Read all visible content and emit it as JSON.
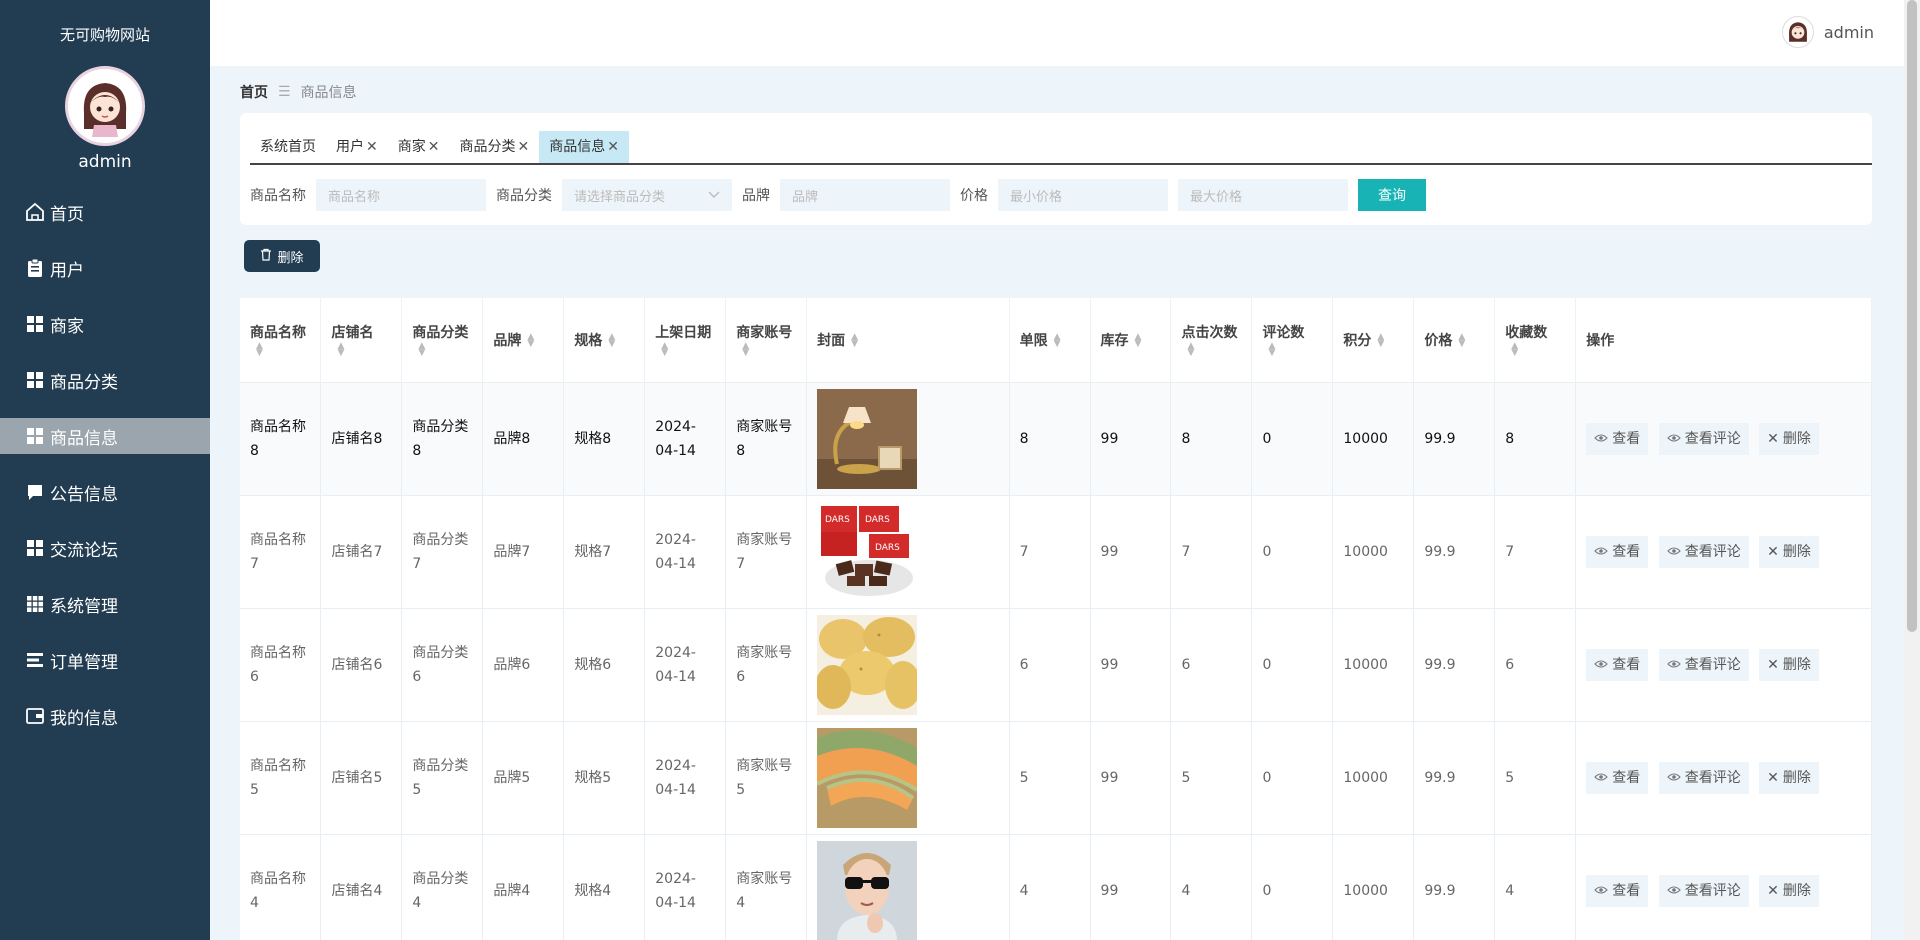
{
  "sidebar": {
    "site_title": "无可购物网站",
    "username": "admin",
    "items": [
      {
        "label": "首页",
        "icon": "home-icon",
        "active": false
      },
      {
        "label": "用户",
        "icon": "clipboard-icon",
        "active": false
      },
      {
        "label": "商家",
        "icon": "grid-icon",
        "active": false
      },
      {
        "label": "商品分类",
        "icon": "grid-icon",
        "active": false
      },
      {
        "label": "商品信息",
        "icon": "grid-icon",
        "active": true
      },
      {
        "label": "公告信息",
        "icon": "chat-icon",
        "active": false
      },
      {
        "label": "交流论坛",
        "icon": "grid-icon",
        "active": false
      },
      {
        "label": "系统管理",
        "icon": "apps-icon",
        "active": false
      },
      {
        "label": "订单管理",
        "icon": "list-icon",
        "active": false
      },
      {
        "label": "我的信息",
        "icon": "wallet-icon",
        "active": false
      }
    ]
  },
  "header": {
    "username": "admin"
  },
  "breadcrumb": {
    "home": "首页",
    "current": "商品信息"
  },
  "tabs": [
    {
      "label": "系统首页",
      "closable": false,
      "active": false
    },
    {
      "label": "用户",
      "closable": true,
      "active": false
    },
    {
      "label": "商家",
      "closable": true,
      "active": false
    },
    {
      "label": "商品分类",
      "closable": true,
      "active": false
    },
    {
      "label": "商品信息",
      "closable": true,
      "active": true
    }
  ],
  "search": {
    "name_label": "商品名称",
    "name_placeholder": "商品名称",
    "category_label": "商品分类",
    "category_placeholder": "请选择商品分类",
    "brand_label": "品牌",
    "brand_placeholder": "品牌",
    "price_label": "价格",
    "min_price_placeholder": "最小价格",
    "max_price_placeholder": "最大价格",
    "query_label": "查询"
  },
  "toolbar": {
    "delete_label": "删除"
  },
  "table": {
    "columns": [
      "商品名称",
      "店铺名",
      "商品分类",
      "品牌",
      "规格",
      "上架日期",
      "商家账号",
      "封面",
      "单限",
      "库存",
      "点击次数",
      "评论数",
      "积分",
      "价格",
      "收藏数",
      "操作"
    ],
    "actions": {
      "view": "查看",
      "comments": "查看评论",
      "delete": "删除"
    },
    "rows": [
      {
        "name": "商品名称8",
        "shop": "店铺名8",
        "category": "商品分类8",
        "brand": "品牌8",
        "spec": "规格8",
        "date": "2024-04-14",
        "merchant": "商家账号8",
        "cover": "lamp",
        "limit": "8",
        "stock": "99",
        "clicks": "8",
        "comments": "0",
        "points": "10000",
        "price": "99.9",
        "favorites": "8"
      },
      {
        "name": "商品名称7",
        "shop": "店铺名7",
        "category": "商品分类7",
        "brand": "品牌7",
        "spec": "规格7",
        "date": "2024-04-14",
        "merchant": "商家账号7",
        "cover": "chocolate",
        "limit": "7",
        "stock": "99",
        "clicks": "7",
        "comments": "0",
        "points": "10000",
        "price": "99.9",
        "favorites": "7"
      },
      {
        "name": "商品名称6",
        "shop": "店铺名6",
        "category": "商品分类6",
        "brand": "品牌6",
        "spec": "规格6",
        "date": "2024-04-14",
        "merchant": "商家账号6",
        "cover": "potato",
        "limit": "6",
        "stock": "99",
        "clicks": "6",
        "comments": "0",
        "points": "10000",
        "price": "99.9",
        "favorites": "6"
      },
      {
        "name": "商品名称5",
        "shop": "店铺名5",
        "category": "商品分类5",
        "brand": "品牌5",
        "spec": "规格5",
        "date": "2024-04-14",
        "merchant": "商家账号5",
        "cover": "melon",
        "limit": "5",
        "stock": "99",
        "clicks": "5",
        "comments": "0",
        "points": "10000",
        "price": "99.9",
        "favorites": "5"
      },
      {
        "name": "商品名称4",
        "shop": "店铺名4",
        "category": "商品分类4",
        "brand": "品牌4",
        "spec": "规格4",
        "date": "2024-04-14",
        "merchant": "商家账号4",
        "cover": "sunglasses",
        "limit": "4",
        "stock": "99",
        "clicks": "4",
        "comments": "0",
        "points": "10000",
        "price": "99.9",
        "favorites": "4"
      }
    ]
  }
}
